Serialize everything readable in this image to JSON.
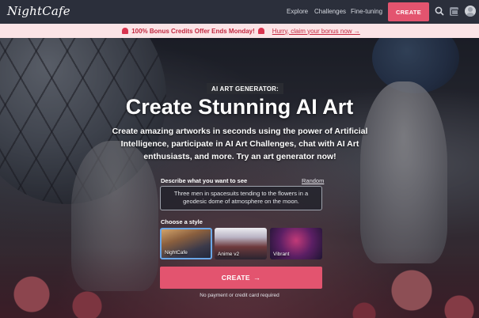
{
  "nav": {
    "logo": "NightCafe",
    "links": [
      "Explore",
      "Challenges",
      "Fine-tuning"
    ],
    "create_label": "CREATE",
    "icons": [
      "search-icon",
      "gallery-icon",
      "avatar"
    ]
  },
  "promo": {
    "bold_text": "100% Bonus Credits Offer Ends Monday!",
    "link_text": "Hurry, claim your bonus now →",
    "icon": "bell-icon",
    "color": "#c2273f"
  },
  "hero": {
    "badge": "AI ART GENERATOR:",
    "title": "Create Stunning AI Art",
    "subtitle": "Create amazing artworks in seconds using the power of Artificial Intelligence, participate in AI Art Challenges, chat with AI Art enthusiasts, and more. Try an art generator now!",
    "prompt_label": "Describe what you want to see",
    "random_label": "Random",
    "prompt_value": "Three men in spacesuits tending to the flowers in a geodesic dome of atmosphere on the moon.",
    "style_label": "Choose a style",
    "styles": [
      {
        "name": "NightCafe",
        "selected": true
      },
      {
        "name": "Anime v2",
        "selected": false
      },
      {
        "name": "Vibrant",
        "selected": false
      }
    ],
    "create_label": "CREATE",
    "create_icon": "arrow-right-icon",
    "note": "No payment or credit card required"
  },
  "colors": {
    "accent": "#e3546f",
    "nav_bg": "#2b2f3b",
    "promo_bg": "#fbe4e6",
    "selected_border": "#6aa7e8"
  }
}
